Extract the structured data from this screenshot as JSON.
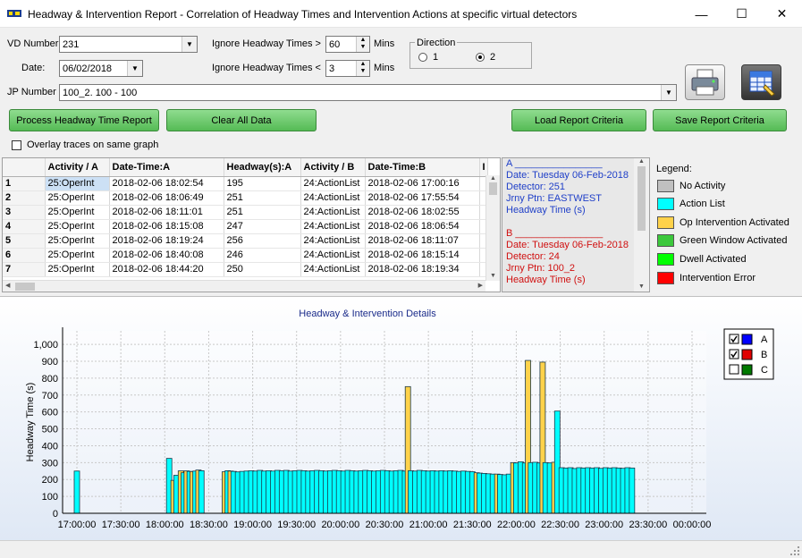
{
  "window": {
    "title": "Headway & Intervention Report - Correlation of Headway Times and Intervention Actions at specific virtual detectors",
    "minimize": "—",
    "maximize": "☐",
    "close": "✕"
  },
  "form": {
    "vd_label": "VD Number",
    "vd_value": "231",
    "date_label": "Date:",
    "date_value": "06/02/2018",
    "ignore_gt_label": "Ignore Headway Times >",
    "ignore_gt_value": "60",
    "ignore_lt_label": "Ignore Headway Times <",
    "ignore_lt_value": "3",
    "mins1": "Mins",
    "mins2": "Mins",
    "direction_label": "Direction",
    "dir1_label": "1",
    "dir2_label": "2",
    "direction_selected": "2",
    "jp_label": "JP Number",
    "jp_value": "100_2. 100 - 100",
    "overlay_label": "Overlay traces on same graph"
  },
  "buttons": {
    "process": "Process  Headway Time Report",
    "clear": "Clear All Data",
    "load": "Load Report Criteria",
    "save": "Save Report Criteria"
  },
  "grid": {
    "headers": [
      "Activity / A",
      "Date-Time:A",
      "Headway(s):A",
      "Activity / B",
      "Date-Time:B",
      "I"
    ],
    "rows": [
      [
        "1",
        "25:OperInt",
        "2018-02-06 18:02:54",
        "195",
        "24:ActionList",
        "2018-02-06 17:00:16"
      ],
      [
        "2",
        "25:OperInt",
        "2018-02-06 18:06:49",
        "251",
        "24:ActionList",
        "2018-02-06 17:55:54"
      ],
      [
        "3",
        "25:OperInt",
        "2018-02-06 18:11:01",
        "251",
        "24:ActionList",
        "2018-02-06 18:02:55"
      ],
      [
        "4",
        "25:OperInt",
        "2018-02-06 18:15:08",
        "247",
        "24:ActionList",
        "2018-02-06 18:06:54"
      ],
      [
        "5",
        "25:OperInt",
        "2018-02-06 18:19:24",
        "256",
        "24:ActionList",
        "2018-02-06 18:11:07"
      ],
      [
        "6",
        "25:OperInt",
        "2018-02-06 18:40:08",
        "246",
        "24:ActionList",
        "2018-02-06 18:15:14"
      ],
      [
        "7",
        "25:OperInt",
        "2018-02-06 18:44:20",
        "250",
        "24:ActionList",
        "2018-02-06 18:19:34"
      ]
    ]
  },
  "info": {
    "a_header": "A ________________",
    "a_date": "Date:   Tuesday 06-Feb-2018",
    "a_detector": "Detector: 251",
    "a_ptn": "Jrny Ptn: EASTWEST",
    "a_metric": "Headway Time (s)",
    "b_header": "B ________________",
    "b_date": "Date:   Tuesday 06-Feb-2018",
    "b_detector": "Detector: 24",
    "b_ptn": "Jrny Ptn: 100_2",
    "b_metric": "Headway Time (s)",
    "color_a": "#1f3fc8",
    "color_b": "#d01010"
  },
  "legend": {
    "title": "Legend:",
    "items": [
      {
        "label": "No Activity",
        "color": "#c0c0c0"
      },
      {
        "label": "Action List",
        "color": "#00ffff"
      },
      {
        "label": "Op Intervention Activated",
        "color": "#ffd24a"
      },
      {
        "label": "Green Window Activated",
        "color": "#3cc83c"
      },
      {
        "label": "Dwell Activated",
        "color": "#00ff00"
      },
      {
        "label": "Intervention Error",
        "color": "#ff0000"
      }
    ]
  },
  "series_legend": [
    {
      "name": "A",
      "checked": true,
      "color": "#0000ff"
    },
    {
      "name": "B",
      "checked": true,
      "color": "#e00000"
    },
    {
      "name": "C",
      "checked": false,
      "color": "#007a00"
    }
  ],
  "chart_data": {
    "type": "bar",
    "title": "Headway & Intervention Details",
    "ylabel": "Headway Time (s)",
    "xlabel": "",
    "ylim": [
      0,
      1080
    ],
    "yticks": [
      "1,000",
      "900",
      "800",
      "700",
      "600",
      "500",
      "400",
      "300",
      "200",
      "100",
      "0"
    ],
    "xticks": [
      "17:00:00",
      "17:30:00",
      "18:00:00",
      "18:30:00",
      "19:00:00",
      "19:30:00",
      "20:00:00",
      "20:30:00",
      "21:00:00",
      "21:30:00",
      "22:00:00",
      "22:30:00",
      "23:00:00",
      "23:30:00",
      "00:00:00"
    ],
    "x_unit": "minutes after 17:00",
    "colors": {
      "action": "#00ffff",
      "oper": "#ffd24a"
    },
    "bars": [
      {
        "t": 0,
        "v": 250,
        "k": "action"
      },
      {
        "t": 63,
        "v": 325,
        "k": "action"
      },
      {
        "t": 66,
        "v": 195,
        "k": "oper"
      },
      {
        "t": 68,
        "v": 225,
        "k": "action"
      },
      {
        "t": 71,
        "v": 251,
        "k": "oper"
      },
      {
        "t": 73,
        "v": 240,
        "k": "action"
      },
      {
        "t": 75,
        "v": 251,
        "k": "oper"
      },
      {
        "t": 77,
        "v": 248,
        "k": "action"
      },
      {
        "t": 79,
        "v": 247,
        "k": "oper"
      },
      {
        "t": 81,
        "v": 250,
        "k": "action"
      },
      {
        "t": 83,
        "v": 256,
        "k": "oper"
      },
      {
        "t": 85,
        "v": 252,
        "k": "action"
      },
      {
        "t": 101,
        "v": 246,
        "k": "oper"
      },
      {
        "t": 103,
        "v": 252,
        "k": "action"
      },
      {
        "t": 105,
        "v": 250,
        "k": "oper"
      },
      {
        "t": 107,
        "v": 248,
        "k": "action"
      },
      {
        "t": 110,
        "v": 245,
        "k": "action"
      },
      {
        "t": 113,
        "v": 248,
        "k": "action"
      },
      {
        "t": 116,
        "v": 250,
        "k": "action"
      },
      {
        "t": 119,
        "v": 252,
        "k": "action"
      },
      {
        "t": 122,
        "v": 250,
        "k": "action"
      },
      {
        "t": 125,
        "v": 254,
        "k": "action"
      },
      {
        "t": 128,
        "v": 250,
        "k": "action"
      },
      {
        "t": 131,
        "v": 252,
        "k": "action"
      },
      {
        "t": 134,
        "v": 250,
        "k": "action"
      },
      {
        "t": 137,
        "v": 254,
        "k": "action"
      },
      {
        "t": 140,
        "v": 252,
        "k": "action"
      },
      {
        "t": 143,
        "v": 254,
        "k": "action"
      },
      {
        "t": 146,
        "v": 250,
        "k": "action"
      },
      {
        "t": 149,
        "v": 252,
        "k": "action"
      },
      {
        "t": 152,
        "v": 254,
        "k": "action"
      },
      {
        "t": 155,
        "v": 252,
        "k": "action"
      },
      {
        "t": 158,
        "v": 250,
        "k": "action"
      },
      {
        "t": 161,
        "v": 252,
        "k": "action"
      },
      {
        "t": 164,
        "v": 254,
        "k": "action"
      },
      {
        "t": 167,
        "v": 252,
        "k": "action"
      },
      {
        "t": 170,
        "v": 250,
        "k": "action"
      },
      {
        "t": 173,
        "v": 252,
        "k": "action"
      },
      {
        "t": 176,
        "v": 254,
        "k": "action"
      },
      {
        "t": 179,
        "v": 252,
        "k": "action"
      },
      {
        "t": 182,
        "v": 250,
        "k": "action"
      },
      {
        "t": 185,
        "v": 254,
        "k": "action"
      },
      {
        "t": 188,
        "v": 252,
        "k": "action"
      },
      {
        "t": 191,
        "v": 250,
        "k": "action"
      },
      {
        "t": 194,
        "v": 252,
        "k": "action"
      },
      {
        "t": 197,
        "v": 254,
        "k": "action"
      },
      {
        "t": 200,
        "v": 252,
        "k": "action"
      },
      {
        "t": 203,
        "v": 250,
        "k": "action"
      },
      {
        "t": 206,
        "v": 252,
        "k": "action"
      },
      {
        "t": 209,
        "v": 254,
        "k": "action"
      },
      {
        "t": 212,
        "v": 252,
        "k": "action"
      },
      {
        "t": 215,
        "v": 250,
        "k": "action"
      },
      {
        "t": 218,
        "v": 252,
        "k": "action"
      },
      {
        "t": 221,
        "v": 254,
        "k": "action"
      },
      {
        "t": 224,
        "v": 250,
        "k": "action"
      },
      {
        "t": 226,
        "v": 750,
        "k": "oper"
      },
      {
        "t": 228,
        "v": 252,
        "k": "action"
      },
      {
        "t": 231,
        "v": 250,
        "k": "action"
      },
      {
        "t": 234,
        "v": 254,
        "k": "action"
      },
      {
        "t": 237,
        "v": 252,
        "k": "action"
      },
      {
        "t": 240,
        "v": 250,
        "k": "action"
      },
      {
        "t": 243,
        "v": 252,
        "k": "action"
      },
      {
        "t": 246,
        "v": 250,
        "k": "action"
      },
      {
        "t": 249,
        "v": 252,
        "k": "action"
      },
      {
        "t": 252,
        "v": 250,
        "k": "action"
      },
      {
        "t": 255,
        "v": 252,
        "k": "action"
      },
      {
        "t": 258,
        "v": 250,
        "k": "action"
      },
      {
        "t": 261,
        "v": 248,
        "k": "action"
      },
      {
        "t": 264,
        "v": 250,
        "k": "action"
      },
      {
        "t": 267,
        "v": 248,
        "k": "action"
      },
      {
        "t": 270,
        "v": 246,
        "k": "action"
      },
      {
        "t": 273,
        "v": 240,
        "k": "oper"
      },
      {
        "t": 275,
        "v": 238,
        "k": "action"
      },
      {
        "t": 278,
        "v": 236,
        "k": "action"
      },
      {
        "t": 281,
        "v": 234,
        "k": "action"
      },
      {
        "t": 284,
        "v": 232,
        "k": "action"
      },
      {
        "t": 287,
        "v": 232,
        "k": "oper"
      },
      {
        "t": 289,
        "v": 230,
        "k": "action"
      },
      {
        "t": 292,
        "v": 228,
        "k": "action"
      },
      {
        "t": 295,
        "v": 232,
        "k": "action"
      },
      {
        "t": 298,
        "v": 300,
        "k": "oper"
      },
      {
        "t": 300,
        "v": 298,
        "k": "action"
      },
      {
        "t": 303,
        "v": 305,
        "k": "action"
      },
      {
        "t": 306,
        "v": 298,
        "k": "action"
      },
      {
        "t": 308,
        "v": 905,
        "k": "oper"
      },
      {
        "t": 310,
        "v": 300,
        "k": "action"
      },
      {
        "t": 313,
        "v": 302,
        "k": "action"
      },
      {
        "t": 316,
        "v": 298,
        "k": "action"
      },
      {
        "t": 318,
        "v": 895,
        "k": "oper"
      },
      {
        "t": 320,
        "v": 300,
        "k": "action"
      },
      {
        "t": 323,
        "v": 298,
        "k": "action"
      },
      {
        "t": 326,
        "v": 302,
        "k": "oper"
      },
      {
        "t": 328,
        "v": 605,
        "k": "action"
      },
      {
        "t": 331,
        "v": 270,
        "k": "action"
      },
      {
        "t": 334,
        "v": 268,
        "k": "action"
      },
      {
        "t": 337,
        "v": 270,
        "k": "action"
      },
      {
        "t": 340,
        "v": 265,
        "k": "action"
      },
      {
        "t": 343,
        "v": 270,
        "k": "action"
      },
      {
        "t": 346,
        "v": 268,
        "k": "action"
      },
      {
        "t": 349,
        "v": 270,
        "k": "action"
      },
      {
        "t": 352,
        "v": 268,
        "k": "action"
      },
      {
        "t": 355,
        "v": 270,
        "k": "action"
      },
      {
        "t": 358,
        "v": 266,
        "k": "action"
      },
      {
        "t": 361,
        "v": 270,
        "k": "action"
      },
      {
        "t": 364,
        "v": 268,
        "k": "action"
      },
      {
        "t": 367,
        "v": 270,
        "k": "action"
      },
      {
        "t": 370,
        "v": 268,
        "k": "action"
      },
      {
        "t": 373,
        "v": 266,
        "k": "action"
      },
      {
        "t": 376,
        "v": 270,
        "k": "action"
      },
      {
        "t": 379,
        "v": 268,
        "k": "action"
      }
    ]
  }
}
